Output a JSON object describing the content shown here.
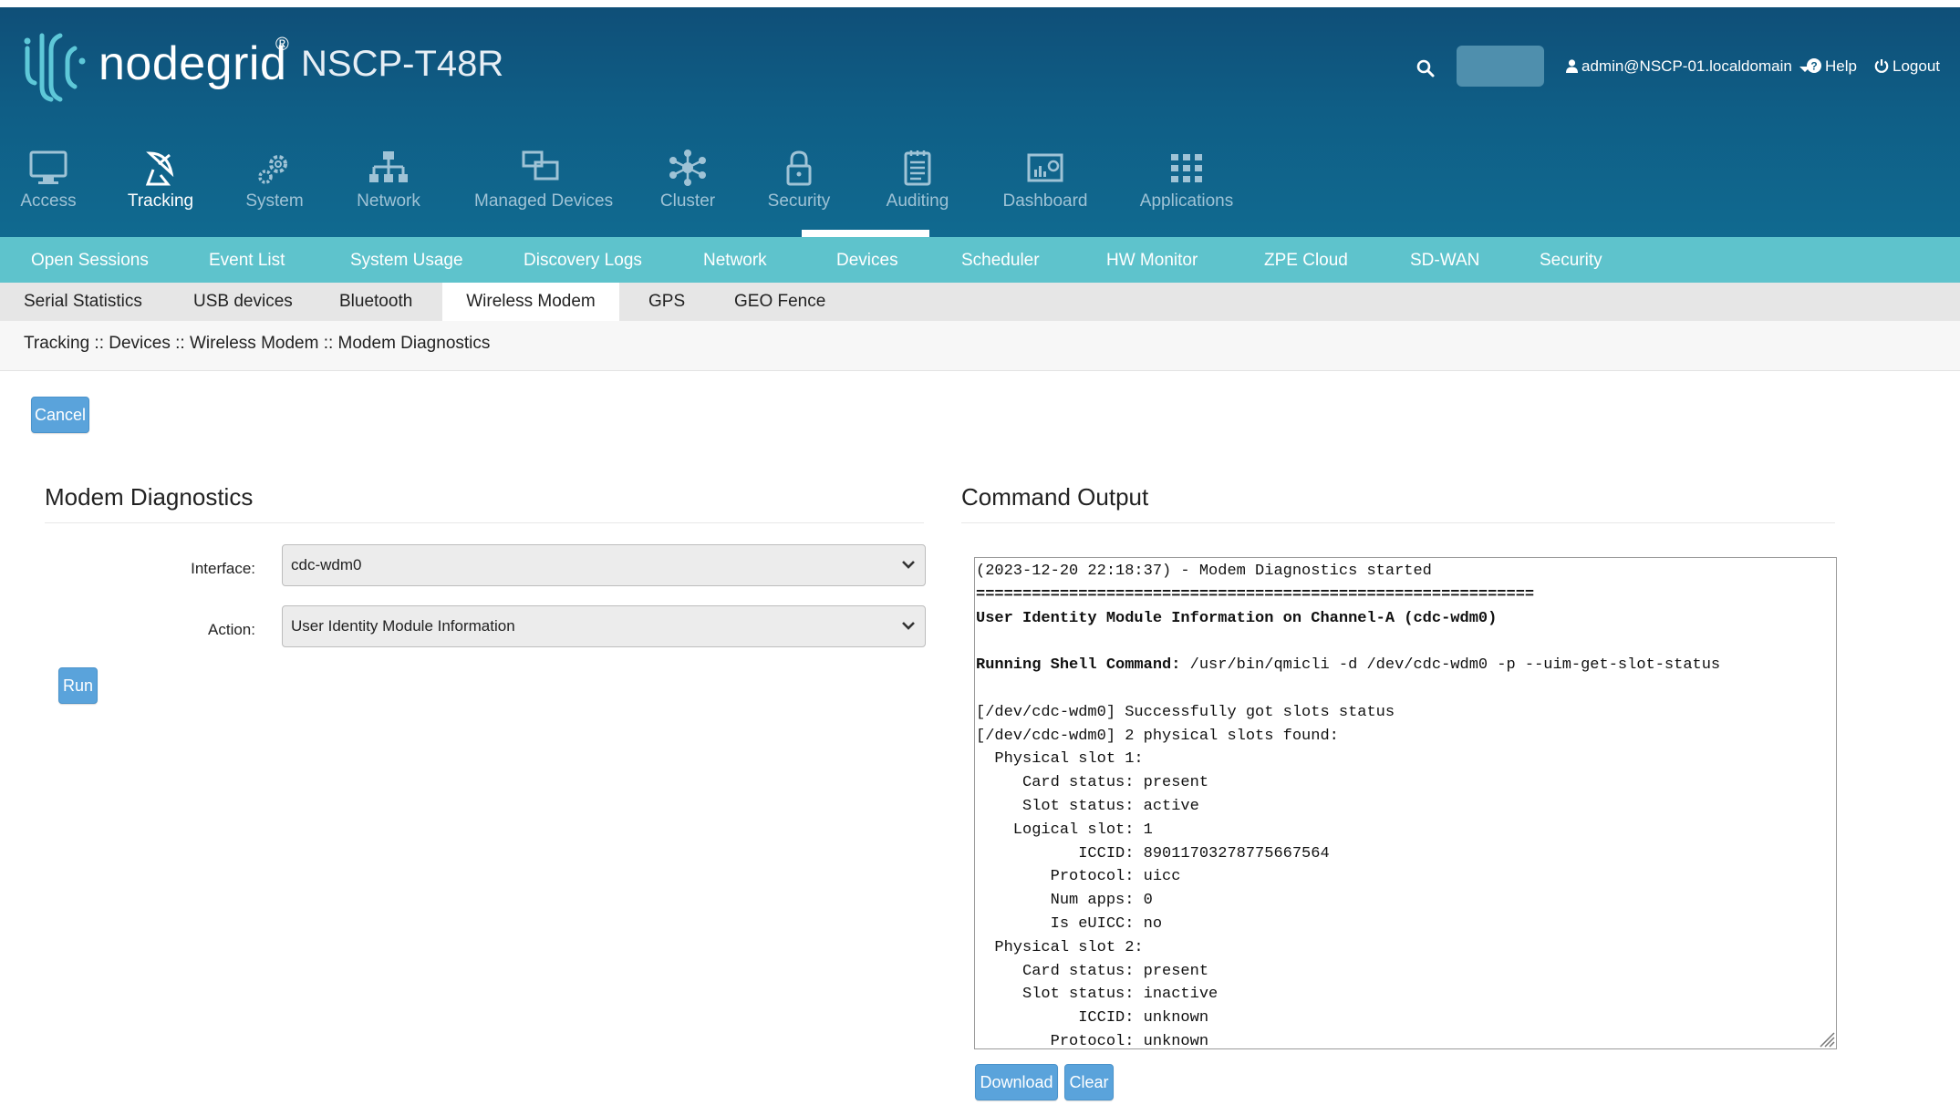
{
  "brand": {
    "logo_text": "nodegrid",
    "logo_reg": "®",
    "device": "NSCP-T48R"
  },
  "header_links": {
    "user": "admin@NSCP-01.localdomain",
    "help": "Help",
    "logout": "Logout"
  },
  "nav": [
    {
      "label": "Access",
      "icon": "monitor-icon"
    },
    {
      "label": "Tracking",
      "icon": "satellite-icon"
    },
    {
      "label": "System",
      "icon": "gears-icon"
    },
    {
      "label": "Network",
      "icon": "network-tree-icon"
    },
    {
      "label": "Managed Devices",
      "icon": "devices-icon"
    },
    {
      "label": "Cluster",
      "icon": "cluster-icon"
    },
    {
      "label": "Security",
      "icon": "lock-icon"
    },
    {
      "label": "Auditing",
      "icon": "notepad-icon"
    },
    {
      "label": "Dashboard",
      "icon": "dashboard-icon"
    },
    {
      "label": "Applications",
      "icon": "grid-icon"
    }
  ],
  "tabs_primary": [
    "Open Sessions",
    "Event List",
    "System Usage",
    "Discovery Logs",
    "Network",
    "Devices",
    "Scheduler",
    "HW Monitor",
    "ZPE Cloud",
    "SD-WAN",
    "Security"
  ],
  "tabs_secondary": [
    "Serial Statistics",
    "USB devices",
    "Bluetooth",
    "Wireless Modem",
    "GPS",
    "GEO Fence"
  ],
  "active_secondary_tab": "Wireless Modem",
  "breadcrumb": "Tracking :: Devices :: Wireless Modem :: Modem Diagnostics",
  "buttons": {
    "cancel": "Cancel",
    "run": "Run",
    "download": "Download",
    "clear": "Clear"
  },
  "form": {
    "title": "Modem Diagnostics",
    "interface_label": "Interface:",
    "interface_value": "cdc-wdm0",
    "action_label": "Action:",
    "action_value": "User Identity Module Information"
  },
  "output": {
    "title": "Command Output",
    "lines": [
      {
        "text": "(2023-12-20 22:18:37) - Modem Diagnostics started"
      },
      {
        "text": "============================================================",
        "bold": true
      },
      {
        "text": "User Identity Module Information on Channel-A (cdc-wdm0)",
        "bold": true
      },
      {
        "text": ""
      },
      {
        "bold_prefix": "Running Shell Command:",
        "text": " /usr/bin/qmicli -d /dev/cdc-wdm0 -p --uim-get-slot-status"
      },
      {
        "text": ""
      },
      {
        "text": "[/dev/cdc-wdm0] Successfully got slots status"
      },
      {
        "text": "[/dev/cdc-wdm0] 2 physical slots found:"
      },
      {
        "text": "  Physical slot 1:"
      },
      {
        "text": "     Card status: present"
      },
      {
        "text": "     Slot status: active"
      },
      {
        "text": "    Logical slot: 1"
      },
      {
        "text": "           ICCID: 89011703278775667564"
      },
      {
        "text": "        Protocol: uicc"
      },
      {
        "text": "        Num apps: 0"
      },
      {
        "text": "        Is eUICC: no"
      },
      {
        "text": "  Physical slot 2:"
      },
      {
        "text": "     Card status: present"
      },
      {
        "text": "     Slot status: inactive"
      },
      {
        "text": "           ICCID: unknown"
      },
      {
        "text": "        Protocol: unknown"
      }
    ]
  },
  "colors": {
    "header": "#0f5e86",
    "tab_bar": "#5ec3cc",
    "button": "#5aa3db"
  }
}
